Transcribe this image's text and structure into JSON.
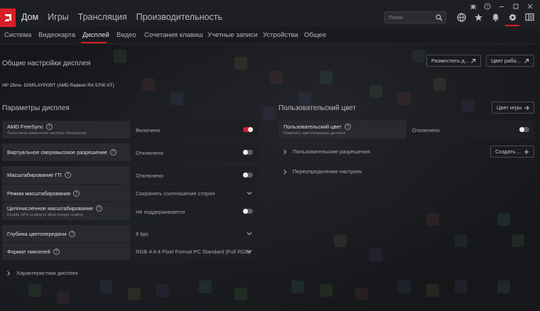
{
  "nav": {
    "items": [
      "Дом",
      "Игры",
      "Трансляция",
      "Производительность"
    ]
  },
  "search": {
    "placeholder": "Поиск"
  },
  "subtabs": [
    "Система",
    "Видеокарта",
    "Дисплей",
    "Видео",
    "Сочетания клавиш",
    "Учетные записи",
    "Устройства",
    "Общее"
  ],
  "active_subtab": "Дисплей",
  "general": {
    "title": "Общие настройки дисплея",
    "btn_layout": "Разместить д...",
    "btn_color_work": "Цвет рабо..."
  },
  "monitor_name": "HP 25mx- DISPLAYPORT (AMD Radeon RX 5700 XT)",
  "params": {
    "title": "Параметры дисплея",
    "rows": [
      {
        "label": "AMD FreeSync",
        "sub": "Технология изменения частоты обновления",
        "value": "Включено",
        "control": "toggle-on"
      },
      {
        "label": "Виртуальное сверхвысокое разрешение",
        "value": "Отключено",
        "control": "toggle-off"
      },
      {
        "label": "Масштабирование ГП",
        "value": "Отключено",
        "control": "toggle-off"
      },
      {
        "label": "Режим масштабирования",
        "value": "Сохранять соотношение сторон",
        "control": "dropdown"
      },
      {
        "label": "Целочисленное масштабирование",
        "sub": "Enable GPU scaling to allow integer scaling.",
        "value": "Не поддерживается",
        "control": "toggle-off"
      },
      {
        "label": "Глубина цветопередачи",
        "value": "8 bpc",
        "control": "dropdown"
      },
      {
        "label": "Формат пикселей",
        "value": "RGB 4:4:4 Pixel Format PC Standard (Full RGB)",
        "control": "dropdown"
      }
    ],
    "characteristics": "Характеристики дисплея"
  },
  "custom_color": {
    "title": "Пользовательский цвет",
    "btn_game_color": "Цвет игры",
    "row_label": "Пользовательский цвет",
    "row_sub": "Изменить цветопередачу дисплея",
    "row_value": "Отключено",
    "custom_res": "Пользовательские разрешения",
    "btn_create": "Создать ...",
    "override": "Переопределение настроек"
  },
  "colors": {
    "accent": "#d71f28",
    "bg": "#16171a",
    "row": "#2a2b2f"
  }
}
